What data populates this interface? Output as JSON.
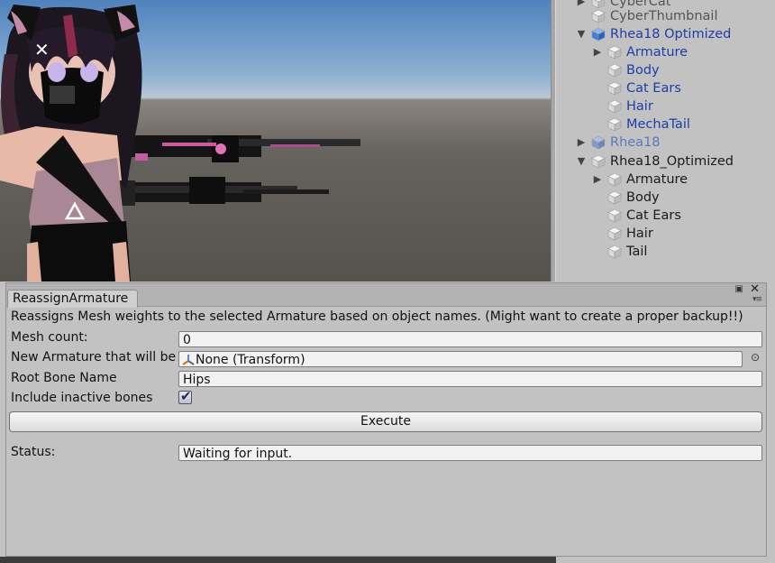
{
  "hierarchy": {
    "items": [
      {
        "label": "CyberCat",
        "style": "gray",
        "arrow": "▶"
      },
      {
        "label": "CyberThumbnail",
        "style": "gray",
        "arrow": ""
      },
      {
        "label": "Rhea18 Optimized",
        "style": "blue",
        "arrow": "▼"
      },
      {
        "label": "Armature",
        "style": "blue",
        "arrow": "▶"
      },
      {
        "label": "Body",
        "style": "blue",
        "arrow": ""
      },
      {
        "label": "Cat Ears",
        "style": "blue",
        "arrow": ""
      },
      {
        "label": "Hair",
        "style": "blue",
        "arrow": ""
      },
      {
        "label": "MechaTail",
        "style": "blue",
        "arrow": ""
      },
      {
        "label": "Rhea18",
        "style": "faded",
        "arrow": "▶"
      },
      {
        "label": "Rhea18_Optimized",
        "style": "plain",
        "arrow": "▼"
      },
      {
        "label": "Armature",
        "style": "plain",
        "arrow": "▶"
      },
      {
        "label": "Body",
        "style": "plain",
        "arrow": ""
      },
      {
        "label": "Cat Ears",
        "style": "plain",
        "arrow": ""
      },
      {
        "label": "Hair",
        "style": "plain",
        "arrow": ""
      },
      {
        "label": "Tail",
        "style": "plain",
        "arrow": ""
      }
    ]
  },
  "window": {
    "tab_title": "ReassignArmature",
    "description": "Reassigns Mesh weights to the selected Armature based on object names. (Might want to create a proper backup!!)",
    "mesh_count_label": "Mesh count:",
    "mesh_count_value": "0",
    "new_armature_label": "New Armature that will be",
    "new_armature_value": "None (Transform)",
    "root_bone_label": "Root Bone Name",
    "root_bone_value": "Hips",
    "include_inactive_label": "Include inactive bones",
    "include_inactive_checked": true,
    "checkmark": "✔",
    "execute_label": "Execute",
    "status_label": "Status:",
    "status_value": "Waiting for input."
  },
  "icons": {
    "close": "✕",
    "maximize": "▣",
    "menu": "▾≡",
    "object_picker": "⊙"
  },
  "colors": {
    "selected_text": "#1b3fa6",
    "panel_bg": "#c2c2c2",
    "field_bg": "#f2f2f2"
  }
}
